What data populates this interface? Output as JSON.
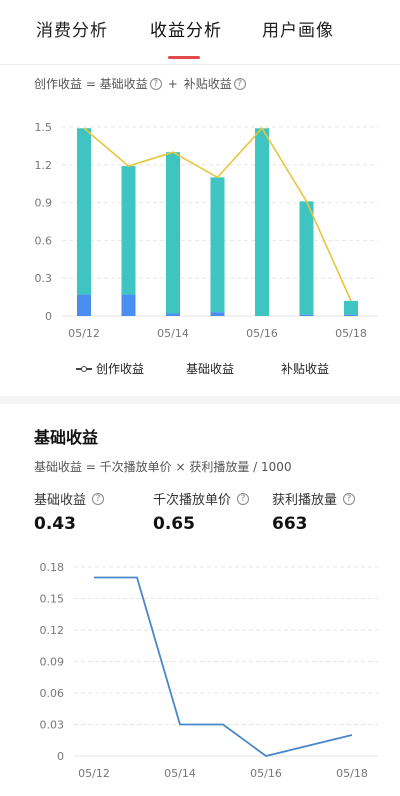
{
  "tabs": [
    {
      "label": "消费分析",
      "active": false
    },
    {
      "label": "收益分析",
      "active": true
    },
    {
      "label": "用户画像",
      "active": false
    }
  ],
  "income_formula": {
    "creative": "创作收益 = 基础收益",
    "plus": "+",
    "subsidy": "补贴收益"
  },
  "legend": {
    "creative": "创作收益",
    "base": "基础收益",
    "subsidy": "补贴收益"
  },
  "base_section": {
    "title": "基础收益",
    "formula": "基础收益 = 千次播放单价 × 获利播放量 / 1000",
    "stats": [
      {
        "label": "基础收益",
        "value": "0.43"
      },
      {
        "label": "千次播放单价",
        "value": "0.65"
      },
      {
        "label": "获利播放量",
        "value": "663"
      }
    ]
  },
  "colors": {
    "base_bar": "#3ec5c2",
    "subsidy_bar": "#4a8ef0",
    "creative_line": "#e8c53a",
    "trend_line": "#4a86c8",
    "tab_underline": "#e24a4a"
  },
  "chart_data": [
    {
      "type": "bar",
      "x": [
        "05/12",
        "05/13",
        "05/14",
        "05/15",
        "05/16",
        "05/17",
        "05/18"
      ],
      "xticks": [
        "05/12",
        "05/14",
        "05/16",
        "05/18"
      ],
      "yticks": [
        "0",
        "0.3",
        "0.6",
        "0.9",
        "1.2",
        "1.5"
      ],
      "ylim": [
        0,
        1.5
      ],
      "stacked": true,
      "series": [
        {
          "name": "补贴收益",
          "values": [
            0.17,
            0.17,
            0.02,
            0.03,
            0.0,
            0.01,
            0.01
          ]
        },
        {
          "name": "基础收益",
          "values": [
            1.32,
            1.02,
            1.28,
            1.07,
            1.49,
            0.9,
            0.11
          ]
        },
        {
          "name": "创作收益",
          "type": "line",
          "values": [
            1.49,
            1.19,
            1.3,
            1.1,
            1.49,
            0.91,
            0.12
          ]
        }
      ],
      "legend_position": "bottom"
    },
    {
      "type": "line",
      "x": [
        "05/12",
        "05/13",
        "05/14",
        "05/15",
        "05/16",
        "05/17",
        "05/18"
      ],
      "xticks": [
        "05/12",
        "05/14",
        "05/16",
        "05/18"
      ],
      "yticks": [
        "0",
        "0.03",
        "0.06",
        "0.09",
        "0.12",
        "0.15",
        "0.18"
      ],
      "ylim": [
        0,
        0.18
      ],
      "series": [
        {
          "values": [
            0.17,
            0.17,
            0.03,
            0.03,
            0.0,
            0.01,
            0.02
          ]
        }
      ]
    }
  ]
}
